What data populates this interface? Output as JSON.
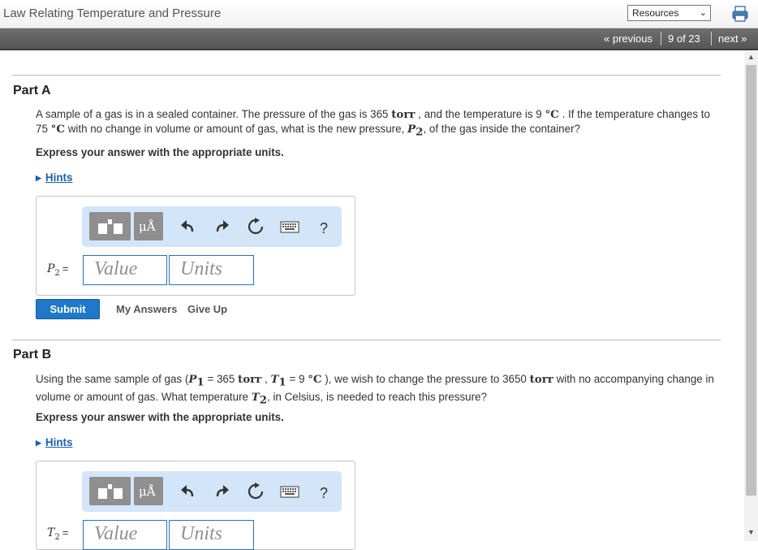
{
  "header": {
    "title": "Law Relating Temperature and Pressure",
    "resources_label": "Resources",
    "print_icon": "printer-icon"
  },
  "nav": {
    "previous": "« previous",
    "count": "9 of 23",
    "next": "next »"
  },
  "partA": {
    "title": "Part A",
    "question": {
      "t1": "A sample of a gas is in a sealed container. The pressure of the gas is 365 ",
      "u1": "torr",
      "t2": " , and the temperature is 9 ",
      "u2": "°C",
      "t3": " . If the temperature changes to 75 ",
      "u3": "°C",
      "t4": " with no change in volume or amount of gas, what is the new pressure, ",
      "var": "P",
      "var_sub": "2",
      "t5": ", of the gas inside the container?"
    },
    "instruction": "Express your answer with the appropriate units.",
    "hints": "Hints",
    "answer": {
      "var": "P",
      "var_sub": "2",
      "eq": "=",
      "value_placeholder": "Value",
      "units_placeholder": "Units"
    },
    "submit": "Submit",
    "my_answers": "My Answers",
    "give_up": "Give Up"
  },
  "partB": {
    "title": "Part B",
    "question": {
      "t1": "Using the same sample of gas (",
      "v1": "P",
      "v1_sub": "1",
      "t2": " = 365 ",
      "u1": "torr",
      "t3": " , ",
      "v2": "T",
      "v2_sub": "1",
      "t4": " = 9 ",
      "u2": "°C",
      "t5": " ), we wish to change the pressure to 3650 ",
      "u3": "torr",
      "t6": " with no accompanying change in volume or amount of gas. What temperature ",
      "v3": "T",
      "v3_sub": "2",
      "t7": ", in Celsius, is needed to reach this pressure?"
    },
    "instruction": "Express your answer with the appropriate units.",
    "hints": "Hints",
    "answer": {
      "var": "T",
      "var_sub": "2",
      "eq": "=",
      "value_placeholder": "Value",
      "units_placeholder": "Units"
    }
  },
  "toolbar": {
    "templates_icon": "templates-icon",
    "units_symbol": "μÅ",
    "undo_icon": "undo-icon",
    "redo_icon": "redo-icon",
    "reset_icon": "reset-icon",
    "keyboard_icon": "keyboard-icon",
    "help": "?"
  },
  "colors": {
    "accent": "#1f78c8",
    "toolbar_bg": "#d3e5f8",
    "nav_bg": "#5e5e5e",
    "link": "#1a5fab"
  }
}
